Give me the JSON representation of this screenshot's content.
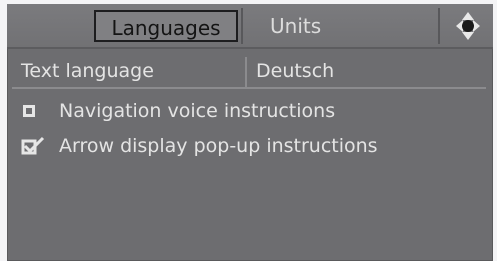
{
  "tabs": {
    "languages_label": "Languages",
    "units_label": "Units"
  },
  "settings": {
    "text_language": {
      "label": "Text language",
      "value": "Deutsch"
    },
    "options": [
      {
        "label": "Navigation voice instructions",
        "checked": false
      },
      {
        "label": "Arrow display pop-up instructions",
        "checked": true
      }
    ]
  },
  "icons": {
    "nav": "navigation-controller-icon",
    "unchecked": "checkbox-empty-icon",
    "checked": "checkbox-checked-icon"
  },
  "colors": {
    "panel_background": "#6d6d70",
    "text": "#e4e4e4",
    "active_tab_border": "#1d1d1f"
  }
}
